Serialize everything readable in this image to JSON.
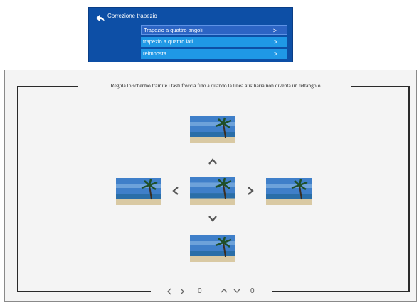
{
  "menu": {
    "title": "Correzione trapezio",
    "items": [
      {
        "label": "Trapezio a quattro angoli",
        "arrow": ">"
      },
      {
        "label": "trapezio a quattro lati",
        "arrow": ">"
      },
      {
        "label": "reimposta",
        "arrow": ">"
      }
    ]
  },
  "screen": {
    "instruction": "Regola lo schermo tramite i tasti freccia fino a quando la linea ausiliaria non diventa un rettangolo",
    "horizontal_value": "0",
    "vertical_value": "0"
  },
  "colors": {
    "menu_bg": "#0d4fa6",
    "item_selected": "#2c64c4",
    "item_bg": "#1f98e6",
    "frame_line": "#2a2a2a"
  },
  "icons": [
    "back-arrow-icon",
    "chevron-right-icon",
    "chevron-up-icon",
    "chevron-down-icon",
    "chevron-left-icon"
  ]
}
